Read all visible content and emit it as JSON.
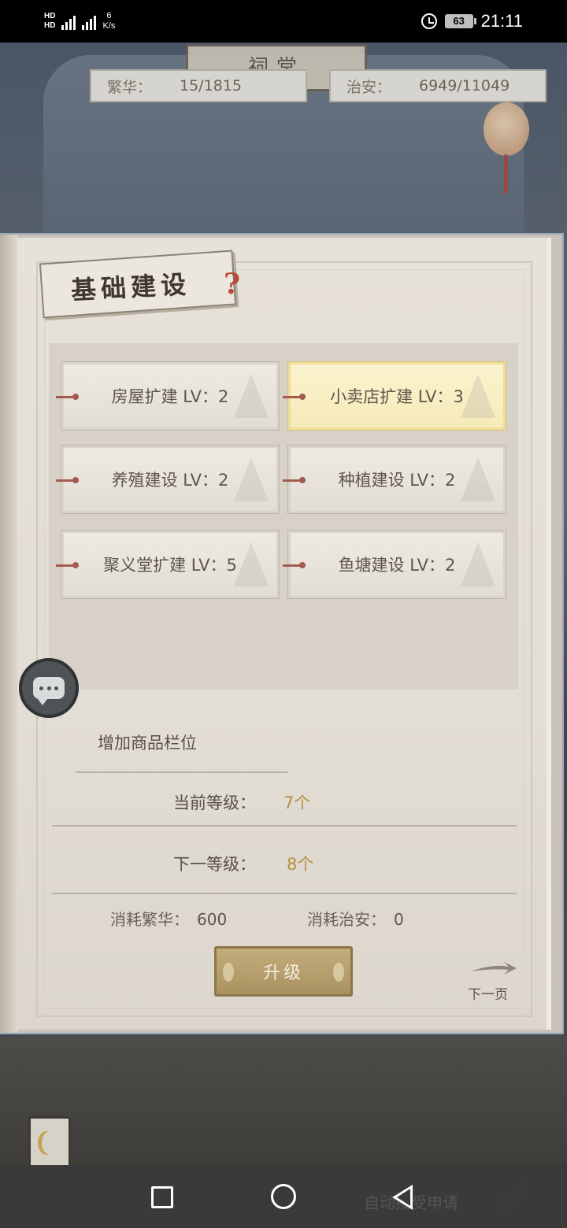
{
  "status_bar": {
    "hd_top": "HD",
    "hd_bottom": "HD",
    "net_top": "6",
    "net_unit": "K/s",
    "battery": "63",
    "time": "21:11"
  },
  "scene": {
    "sign_text": "祠堂",
    "prosperity_label": "繁华：",
    "prosperity_value": "15/1815",
    "security_label": "治安：",
    "security_value": "6949/11049"
  },
  "panel": {
    "title": "基础建设",
    "help_icon": "?",
    "options": [
      {
        "label": "房屋扩建 LV：2",
        "selected": false
      },
      {
        "label": "小卖店扩建 LV：3",
        "selected": true
      },
      {
        "label": "养殖建设 LV：2",
        "selected": false
      },
      {
        "label": "种植建设 LV：2",
        "selected": false
      },
      {
        "label": "聚义堂扩建 LV：5",
        "selected": false
      },
      {
        "label": "鱼塘建设 LV：2",
        "selected": false
      }
    ],
    "description": "增加商品栏位",
    "current_level_label": "当前等级：",
    "current_level_value": "7个",
    "next_level_label": "下一等级：",
    "next_level_value": "8个",
    "cost_prosperity_label": "消耗繁华：",
    "cost_prosperity_value": "600",
    "cost_security_label": "消耗治安：",
    "cost_security_value": "0",
    "upgrade_label": "升级",
    "next_page_label": "下一页"
  },
  "bottom": {
    "auto_accept_label": "自动接受申请"
  },
  "colors": {
    "selected_bg": "#f5eab8",
    "upgrade_button": "#b39c6c",
    "level_value": "#b8903f",
    "help_icon": "#b54c3a"
  }
}
